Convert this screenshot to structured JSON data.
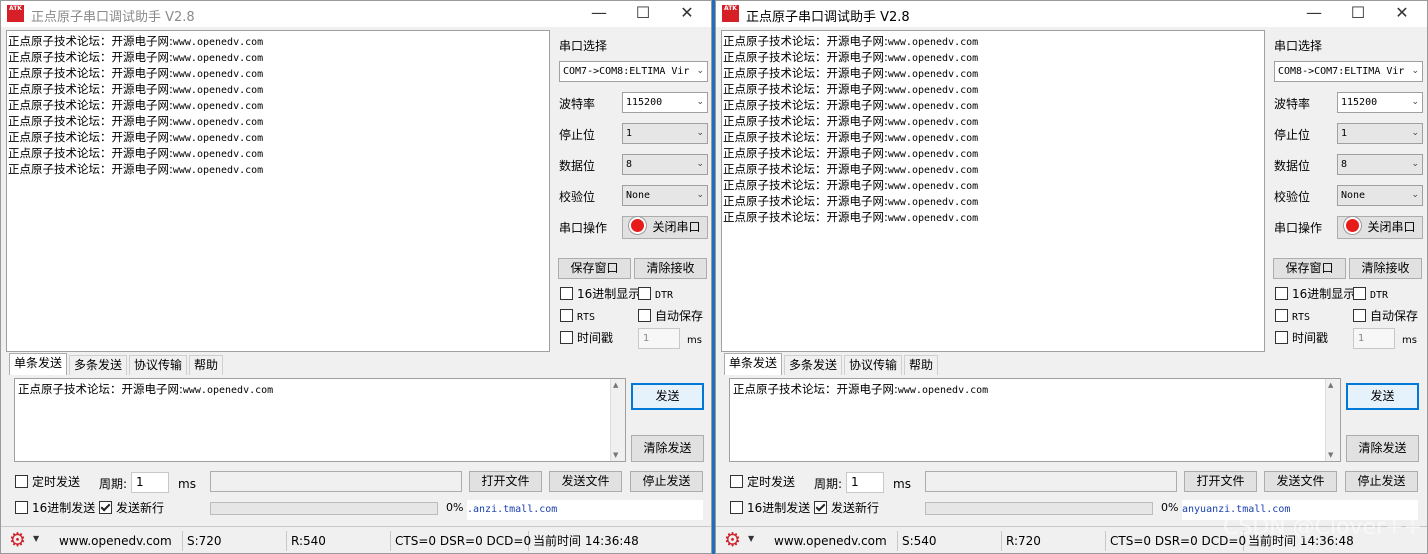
{
  "windows": [
    {
      "title": "正点原子串口调试助手 V2.8",
      "logo": "ATK",
      "recv_lines": [
        {
          "cn": "正点原子技术论坛：开源电子网:",
          "url": "www.openedv.com"
        },
        {
          "cn": "正点原子技术论坛：开源电子网:",
          "url": "www.openedv.com"
        },
        {
          "cn": "正点原子技术论坛：开源电子网:",
          "url": "www.openedv.com"
        },
        {
          "cn": "正点原子技术论坛：开源电子网:",
          "url": "www.openedv.com"
        },
        {
          "cn": "正点原子技术论坛：开源电子网:",
          "url": "www.openedv.com"
        },
        {
          "cn": "正点原子技术论坛：开源电子网:",
          "url": "www.openedv.com"
        },
        {
          "cn": "正点原子技术论坛：开源电子网:",
          "url": "www.openedv.com"
        },
        {
          "cn": "正点原子技术论坛：开源电子网:",
          "url": "www.openedv.com"
        },
        {
          "cn": "正点原子技术论坛：开源电子网:",
          "url": "www.openedv.com"
        }
      ],
      "port_select_label": "串口选择",
      "port_value": "COM7->COM8:ELTIMA Vir",
      "baud_label": "波特率",
      "baud_value": "115200",
      "stop_label": "停止位",
      "stop_value": "1",
      "data_label": "数据位",
      "data_value": "8",
      "parity_label": "校验位",
      "parity_value": "None",
      "op_label": "串口操作",
      "close_port": "关闭串口",
      "save_window": "保存窗口",
      "clear_recv": "清除接收",
      "hex_display": "16进制显示",
      "dtr": "DTR",
      "rts": "RTS",
      "auto_save": "自动保存",
      "timestamp": "时间戳",
      "timestamp_value": "1",
      "ms": "ms",
      "tabs": [
        "单条发送",
        "多条发送",
        "协议传输",
        "帮助"
      ],
      "send_cn": "正点原子技术论坛：开源电子网:",
      "send_url": "www.openedv.com",
      "send_btn": "发送",
      "clear_send": "清除发送",
      "timed_send": "定时发送",
      "period_label": "周期:",
      "period_value": "1",
      "period_unit": "ms",
      "open_file": "打开文件",
      "send_file": "发送文件",
      "stop_send": "停止发送",
      "hex_send": "16进制发送",
      "send_newline": "发送新行",
      "progress_pct": "0%",
      "progress": 0,
      "link_text": ".anzi.tmall.com",
      "status_url": "www.openedv.com",
      "status_s": "S:720",
      "status_r": "R:540",
      "status_lines": "CTS=0 DSR=0 DCD=0",
      "status_time": "当前时间 14:36:48"
    },
    {
      "title": "正点原子串口调试助手 V2.8",
      "logo": "ATK",
      "recv_lines": [
        {
          "cn": "正点原子技术论坛：开源电子网:",
          "url": "www.openedv.com"
        },
        {
          "cn": "正点原子技术论坛：开源电子网:",
          "url": "www.openedv.com"
        },
        {
          "cn": "正点原子技术论坛：开源电子网:",
          "url": "www.openedv.com"
        },
        {
          "cn": "正点原子技术论坛：开源电子网:",
          "url": "www.openedv.com"
        },
        {
          "cn": "正点原子技术论坛：开源电子网:",
          "url": "www.openedv.com"
        },
        {
          "cn": "正点原子技术论坛：开源电子网:",
          "url": "www.openedv.com"
        },
        {
          "cn": "正点原子技术论坛：开源电子网:",
          "url": "www.openedv.com"
        },
        {
          "cn": "正点原子技术论坛：开源电子网:",
          "url": "www.openedv.com"
        },
        {
          "cn": "正点原子技术论坛：开源电子网:",
          "url": "www.openedv.com"
        },
        {
          "cn": "正点原子技术论坛：开源电子网:",
          "url": "www.openedv.com"
        },
        {
          "cn": "正点原子技术论坛：开源电子网:",
          "url": "www.openedv.com"
        },
        {
          "cn": "正点原子技术论坛：开源电子网:",
          "url": "www.openedv.com"
        }
      ],
      "port_select_label": "串口选择",
      "port_value": "COM8->COM7:ELTIMA Vir",
      "baud_label": "波特率",
      "baud_value": "115200",
      "stop_label": "停止位",
      "stop_value": "1",
      "data_label": "数据位",
      "data_value": "8",
      "parity_label": "校验位",
      "parity_value": "None",
      "op_label": "串口操作",
      "close_port": "关闭串口",
      "save_window": "保存窗口",
      "clear_recv": "清除接收",
      "hex_display": "16进制显示",
      "dtr": "DTR",
      "rts": "RTS",
      "auto_save": "自动保存",
      "timestamp": "时间戳",
      "timestamp_value": "1",
      "ms": "ms",
      "tabs": [
        "单条发送",
        "多条发送",
        "协议传输",
        "帮助"
      ],
      "send_cn": "正点原子技术论坛：开源电子网:",
      "send_url": "www.openedv.com",
      "send_btn": "发送",
      "clear_send": "清除发送",
      "timed_send": "定时发送",
      "period_label": "周期:",
      "period_value": "1",
      "period_unit": "ms",
      "open_file": "打开文件",
      "send_file": "发送文件",
      "stop_send": "停止发送",
      "hex_send": "16进制发送",
      "send_newline": "发送新行",
      "progress_pct": "0%",
      "progress": 0,
      "link_text": "anyuanzi.tmall.com",
      "status_url": "www.openedv.com",
      "status_s": "S:540",
      "status_r": "R:720",
      "status_lines": "CTS=0 DSR=0 DCD=0",
      "status_time": "当前时间 14:36:48"
    }
  ],
  "watermark": "CSDN @Clover++"
}
